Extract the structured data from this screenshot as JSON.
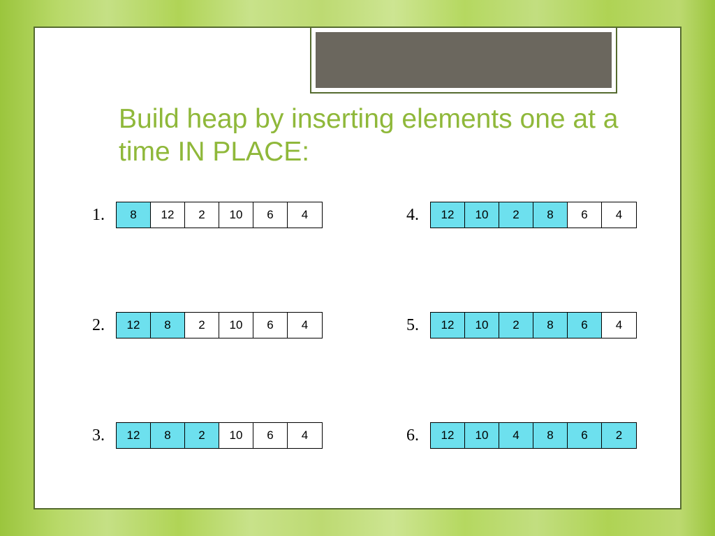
{
  "title": "Build heap by inserting elements one at a time IN PLACE:",
  "colors": {
    "accent": "#8fb83a",
    "highlight": "#6de0ee",
    "frame": "#556b2f",
    "tab": "#6b675e"
  },
  "steps": [
    {
      "label": "1.",
      "cells": [
        {
          "v": "8",
          "hl": true
        },
        {
          "v": "12",
          "hl": false
        },
        {
          "v": "2",
          "hl": false
        },
        {
          "v": "10",
          "hl": false
        },
        {
          "v": "6",
          "hl": false
        },
        {
          "v": "4",
          "hl": false
        }
      ]
    },
    {
      "label": "2.",
      "cells": [
        {
          "v": "12",
          "hl": true
        },
        {
          "v": "8",
          "hl": true
        },
        {
          "v": "2",
          "hl": false
        },
        {
          "v": "10",
          "hl": false
        },
        {
          "v": "6",
          "hl": false
        },
        {
          "v": "4",
          "hl": false
        }
      ]
    },
    {
      "label": "3.",
      "cells": [
        {
          "v": "12",
          "hl": true
        },
        {
          "v": "8",
          "hl": true
        },
        {
          "v": "2",
          "hl": true
        },
        {
          "v": "10",
          "hl": false
        },
        {
          "v": "6",
          "hl": false
        },
        {
          "v": "4",
          "hl": false
        }
      ]
    },
    {
      "label": "4.",
      "cells": [
        {
          "v": "12",
          "hl": true
        },
        {
          "v": "10",
          "hl": true
        },
        {
          "v": "2",
          "hl": true
        },
        {
          "v": "8",
          "hl": true
        },
        {
          "v": "6",
          "hl": false
        },
        {
          "v": "4",
          "hl": false
        }
      ]
    },
    {
      "label": "5.",
      "cells": [
        {
          "v": "12",
          "hl": true
        },
        {
          "v": "10",
          "hl": true
        },
        {
          "v": "2",
          "hl": true
        },
        {
          "v": "8",
          "hl": true
        },
        {
          "v": "6",
          "hl": true
        },
        {
          "v": "4",
          "hl": false
        }
      ]
    },
    {
      "label": "6.",
      "cells": [
        {
          "v": "12",
          "hl": true
        },
        {
          "v": "10",
          "hl": true
        },
        {
          "v": "4",
          "hl": true
        },
        {
          "v": "8",
          "hl": true
        },
        {
          "v": "6",
          "hl": true
        },
        {
          "v": "2",
          "hl": true
        }
      ]
    }
  ]
}
